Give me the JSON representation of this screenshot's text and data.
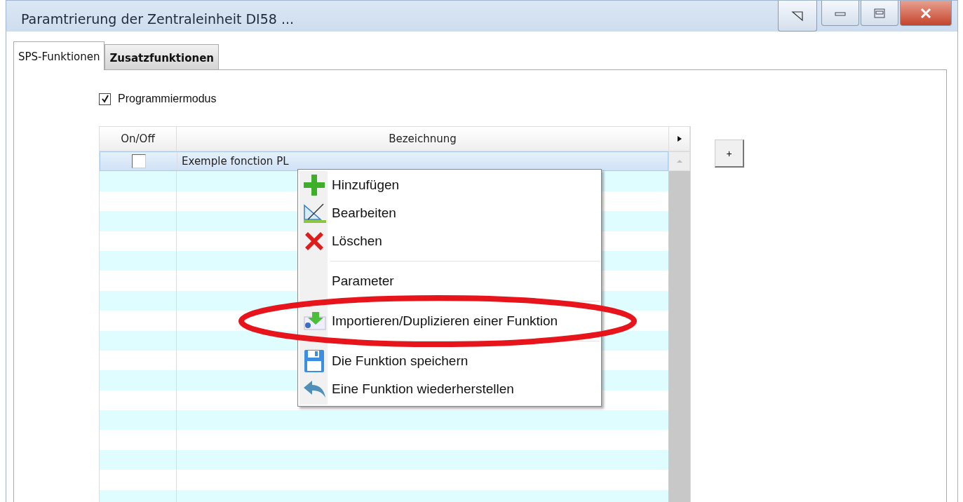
{
  "window": {
    "title": "Paramtrierung der Zentraleinheit DI58 ..."
  },
  "tabs": [
    {
      "label": "SPS-Funktionen",
      "selected": true
    },
    {
      "label": "Zusatzfunktionen",
      "selected": false
    }
  ],
  "programming_mode": {
    "label": "Programmiermodus",
    "checked": true
  },
  "table": {
    "columns": [
      "On/Off",
      "Bezeichnung"
    ],
    "rows": [
      {
        "on": false,
        "name": "Exemple fonction PL",
        "selected": true
      }
    ]
  },
  "add_button": {
    "label": "+"
  },
  "context_menu": [
    {
      "kind": "item",
      "label": "Hinzufügen",
      "highlighted": false
    },
    {
      "kind": "item",
      "label": "Bearbeiten",
      "highlighted": false
    },
    {
      "kind": "item",
      "label": "Löschen",
      "highlighted": false
    },
    {
      "kind": "separator"
    },
    {
      "kind": "item",
      "label": "Parameter",
      "highlighted": false
    },
    {
      "kind": "separator"
    },
    {
      "kind": "item",
      "label": "Importieren/Duplizieren einer Funktion",
      "highlighted": true
    },
    {
      "kind": "separator"
    },
    {
      "kind": "item",
      "label": "Die Funktion speichern",
      "highlighted": false
    },
    {
      "kind": "item",
      "label": "Eine Funktion wiederherstellen",
      "highlighted": false
    }
  ]
}
